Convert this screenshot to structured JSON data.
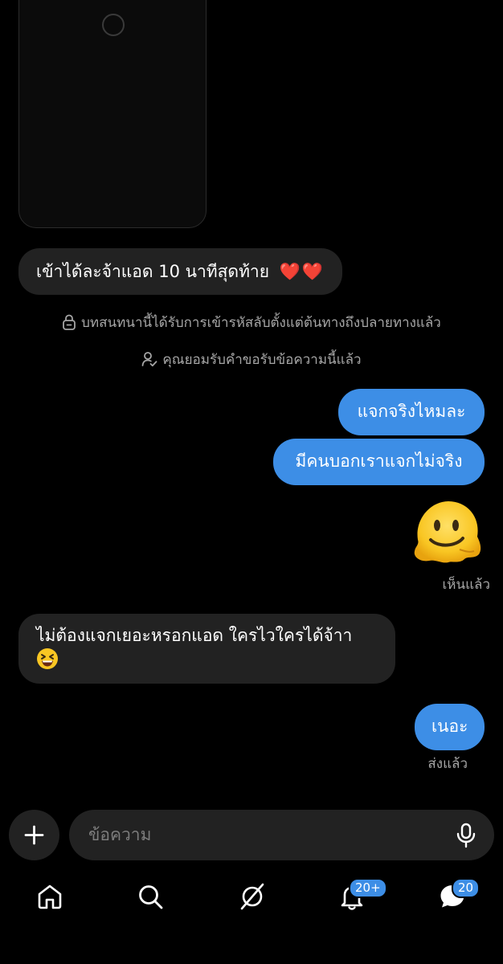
{
  "thread": {
    "incoming_1": {
      "text": "เข้าได้ละจ้าแอด 10 นาทีสุดท้าย",
      "emoji": "❤️❤️"
    },
    "system_encrypted": "บทสนทนานี้ได้รับการเข้ารหัสลับตั้งแต่ต้นทางถึงปลายทางแล้ว",
    "system_accepted": "คุณยอมรับคำขอรับข้อความนี้แล้ว",
    "outgoing_1": "แจกจริงไหมละ",
    "outgoing_2": "มีคนบอกเราแจกไม่จริง",
    "status_seen": "เห็นแล้ว",
    "incoming_2": "ไม่ต้องแจกเยอะหรอกแอด ใครไวใครได้จ้าา",
    "outgoing_3": "เนอะ",
    "status_sent": "ส่งแล้ว"
  },
  "composer": {
    "placeholder": "ข้อความ",
    "plus_icon": "plus-icon",
    "mic_icon": "microphone-icon"
  },
  "bottom_nav": {
    "items": [
      {
        "icon": "home-icon"
      },
      {
        "icon": "search-icon"
      },
      {
        "icon": "feeds-icon"
      },
      {
        "icon": "bell-icon",
        "badge": "20+"
      },
      {
        "icon": "chat-icon",
        "badge": "20"
      }
    ]
  },
  "colors": {
    "background": "#000000",
    "incoming_bubble": "#222222",
    "outgoing_bubble": "#3d8ee6",
    "secondary_text": "#a6a6a6",
    "badge": "#3d8ee6"
  }
}
